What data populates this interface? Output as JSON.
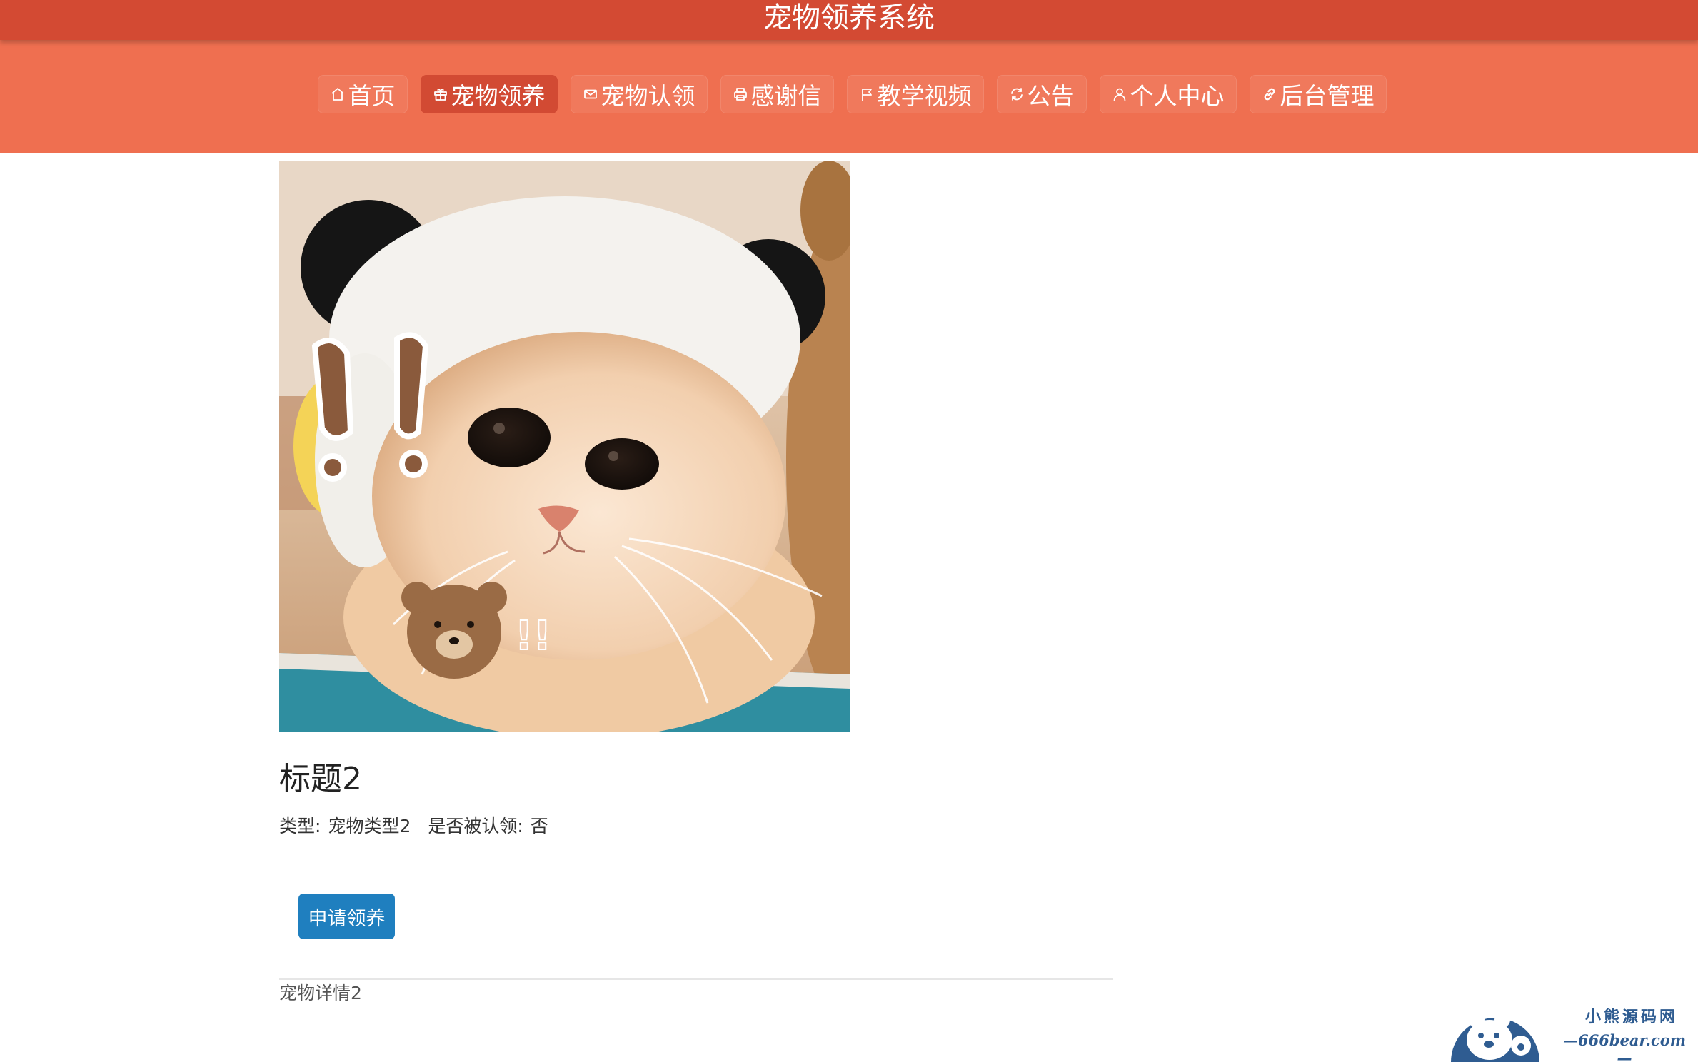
{
  "header": {
    "title": "宠物领养系统"
  },
  "nav": {
    "items": [
      {
        "label": "首页",
        "icon": "home-icon",
        "active": false
      },
      {
        "label": "宠物领养",
        "icon": "gift-icon",
        "active": true
      },
      {
        "label": "宠物认领",
        "icon": "mail-icon",
        "active": false
      },
      {
        "label": "感谢信",
        "icon": "printer-icon",
        "active": false
      },
      {
        "label": "教学视频",
        "icon": "flag-icon",
        "active": false
      },
      {
        "label": "公告",
        "icon": "sync-icon",
        "active": false
      },
      {
        "label": "个人中心",
        "icon": "user-icon",
        "active": false
      },
      {
        "label": "后台管理",
        "icon": "link-icon",
        "active": false
      }
    ]
  },
  "pet": {
    "image": "pet-photo",
    "title": "标题2",
    "type_label": "类型:",
    "type_value": "宠物类型2",
    "claimed_label": "是否被认领:",
    "claimed_value": "否",
    "apply_button": "申请领养",
    "detail": "宠物详情2"
  },
  "watermark": {
    "cn": "小熊源码网",
    "url": "—666bear.com—"
  },
  "colors": {
    "topbar": "#d34a33",
    "navbar": "#ef6f50",
    "active_nav": "#d24a33",
    "button": "#1f7fbf",
    "watermark": "#2f5c91"
  }
}
